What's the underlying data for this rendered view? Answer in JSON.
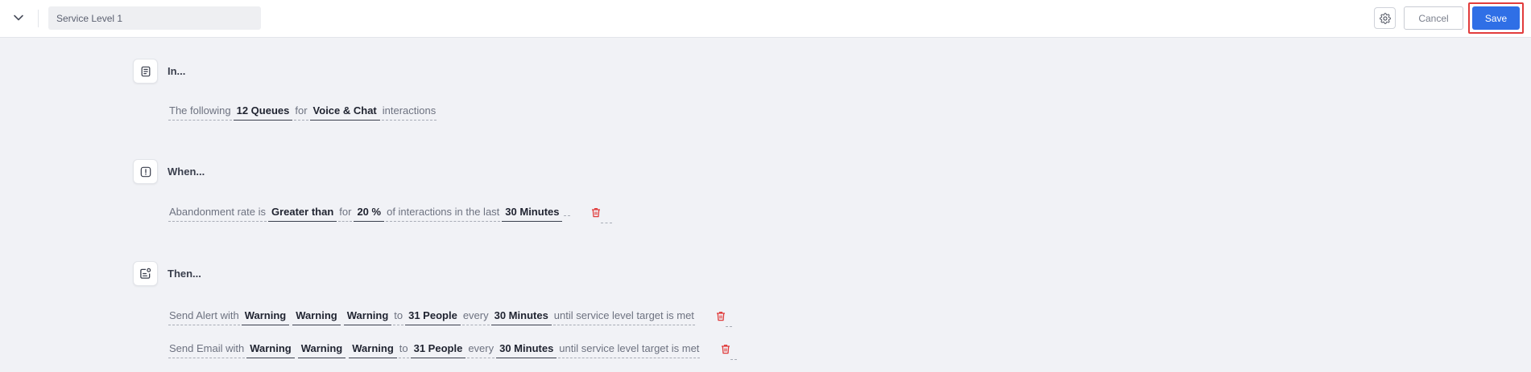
{
  "header": {
    "collapse_icon": "chevron-down-icon",
    "name_value": "Service Level 1",
    "settings_icon": "gear-icon",
    "cancel_label": "Cancel",
    "save_label": "Save"
  },
  "sections": {
    "in": {
      "icon": "document-list-icon",
      "title": "In...",
      "rule": [
        "The following",
        "12 Queues",
        "for",
        "Voice & Chat",
        "interactions"
      ]
    },
    "when": {
      "icon": "alert-square-icon",
      "title": "When...",
      "rule": [
        "Abandonment rate is",
        "Greater than",
        "for",
        "20 %",
        "of interactions in the last",
        "30 Minutes"
      ],
      "delete_icon": "trash-icon"
    },
    "then": {
      "icon": "notification-task-icon",
      "title": "Then...",
      "rules": [
        {
          "parts": [
            "Send Alert with",
            "Warning",
            "Warning",
            "Warning",
            "to",
            "31 People",
            "every",
            "30 Minutes",
            "until service level target is met"
          ],
          "delete_icon": "trash-icon"
        },
        {
          "parts": [
            "Send Email with",
            "Warning",
            "Warning",
            "Warning",
            "to",
            "31 People",
            "every",
            "30 Minutes",
            "until service level target is met"
          ],
          "delete_icon": "trash-icon"
        }
      ]
    }
  },
  "colors": {
    "accent": "#2f6fe6",
    "highlight_border": "#e23c3c",
    "delete": "#e03b3b",
    "background": "#f1f2f6"
  }
}
